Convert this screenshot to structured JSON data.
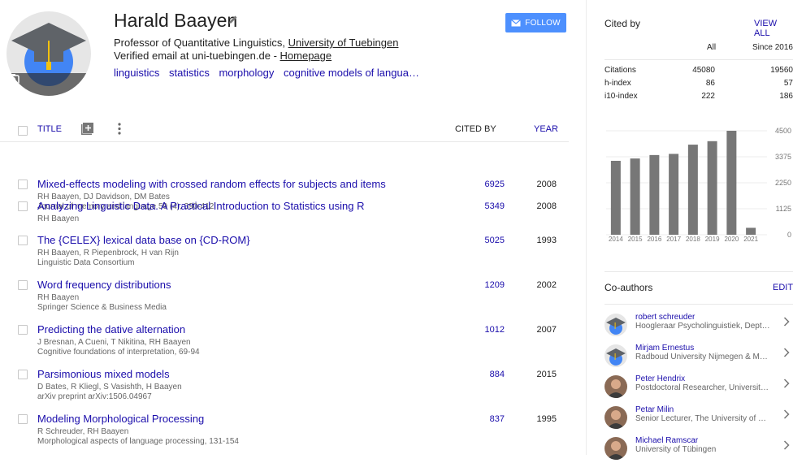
{
  "profile": {
    "name": "Harald Baayen",
    "affiliation_prefix": "Professor of Quantitative Linguistics, ",
    "affiliation_link": "University of Tuebingen",
    "email_prefix": "Verified email at uni-tuebingen.de - ",
    "homepage_link": "Homepage",
    "interests": [
      "linguistics",
      "statistics",
      "morphology",
      "cognitive models of langua…"
    ],
    "follow_label": "FOLLOW"
  },
  "table": {
    "title_header": "TITLE",
    "cited_header": "CITED BY",
    "year_header": "YEAR",
    "rows": [
      {
        "title": "Mixed-effects modeling with crossed random effects for subjects and items",
        "authors": "RH Baayen, DJ Davidson, DM Bates",
        "venue": "Journal of memory and language 59 (4), 390-412",
        "cited": "6925",
        "year": "2008"
      },
      {
        "title": "Analyzing Linguistic Data. A Practical Introduction to Statistics using R",
        "authors": "RH Baayen",
        "venue": "",
        "cited": "5349",
        "year": "2008"
      },
      {
        "title": "The {CELEX} lexical data base on {CD-ROM}",
        "authors": "RH Baayen, R Piepenbrock, H van Rijn",
        "venue": "Linguistic Data Consortium",
        "cited": "5025",
        "year": "1993"
      },
      {
        "title": "Word frequency distributions",
        "authors": "RH Baayen",
        "venue": "Springer Science & Business Media",
        "cited": "1209",
        "year": "2002"
      },
      {
        "title": "Predicting the dative alternation",
        "authors": "J Bresnan, A Cueni, T Nikitina, RH Baayen",
        "venue": "Cognitive foundations of interpretation, 69-94",
        "cited": "1012",
        "year": "2007"
      },
      {
        "title": "Parsimonious mixed models",
        "authors": "D Bates, R Kliegl, S Vasishth, H Baayen",
        "venue": "arXiv preprint arXiv:1506.04967",
        "cited": "884",
        "year": "2015"
      },
      {
        "title": "Modeling Morphological Processing",
        "authors": "R Schreuder, RH Baayen",
        "venue": "Morphological aspects of language processing, 131-154",
        "cited": "837",
        "year": "1995"
      }
    ]
  },
  "cited_by": {
    "heading": "Cited by",
    "view_all": "VIEW ALL",
    "col_all": "All",
    "col_since": "Since 2016",
    "stats": [
      {
        "label": "Citations",
        "all": "45080",
        "since": "19560"
      },
      {
        "label": "h-index",
        "all": "86",
        "since": "57"
      },
      {
        "label": "i10-index",
        "all": "222",
        "since": "186"
      }
    ]
  },
  "chart_data": {
    "type": "bar",
    "categories": [
      "2014",
      "2015",
      "2016",
      "2017",
      "2018",
      "2019",
      "2020",
      "2021"
    ],
    "values": [
      3200,
      3300,
      3450,
      3500,
      3900,
      4050,
      4500,
      300
    ],
    "ylim": [
      0,
      4500
    ],
    "yticks": [
      "4500",
      "3375",
      "2250",
      "1125",
      "0"
    ],
    "bar_color": "#777777"
  },
  "coauthors": {
    "heading": "Co-authors",
    "edit": "EDIT",
    "items": [
      {
        "name": "robert schreuder",
        "affil": "Hoogleraar Psycholinguistiek, Dept. of Psychology",
        "photo": "default"
      },
      {
        "name": "Mirjam Ernestus",
        "affil": "Radboud University Nijmegen & Max Planck Institute",
        "photo": "default"
      },
      {
        "name": "Peter Hendrix",
        "affil": "Postdoctoral Researcher, University of Tuebingen",
        "photo": "person"
      },
      {
        "name": "Petar Milin",
        "affil": "Senior Lecturer, The University of Birmingham",
        "photo": "person"
      },
      {
        "name": "Michael Ramscar",
        "affil": "University of Tübingen",
        "photo": "person"
      }
    ]
  }
}
